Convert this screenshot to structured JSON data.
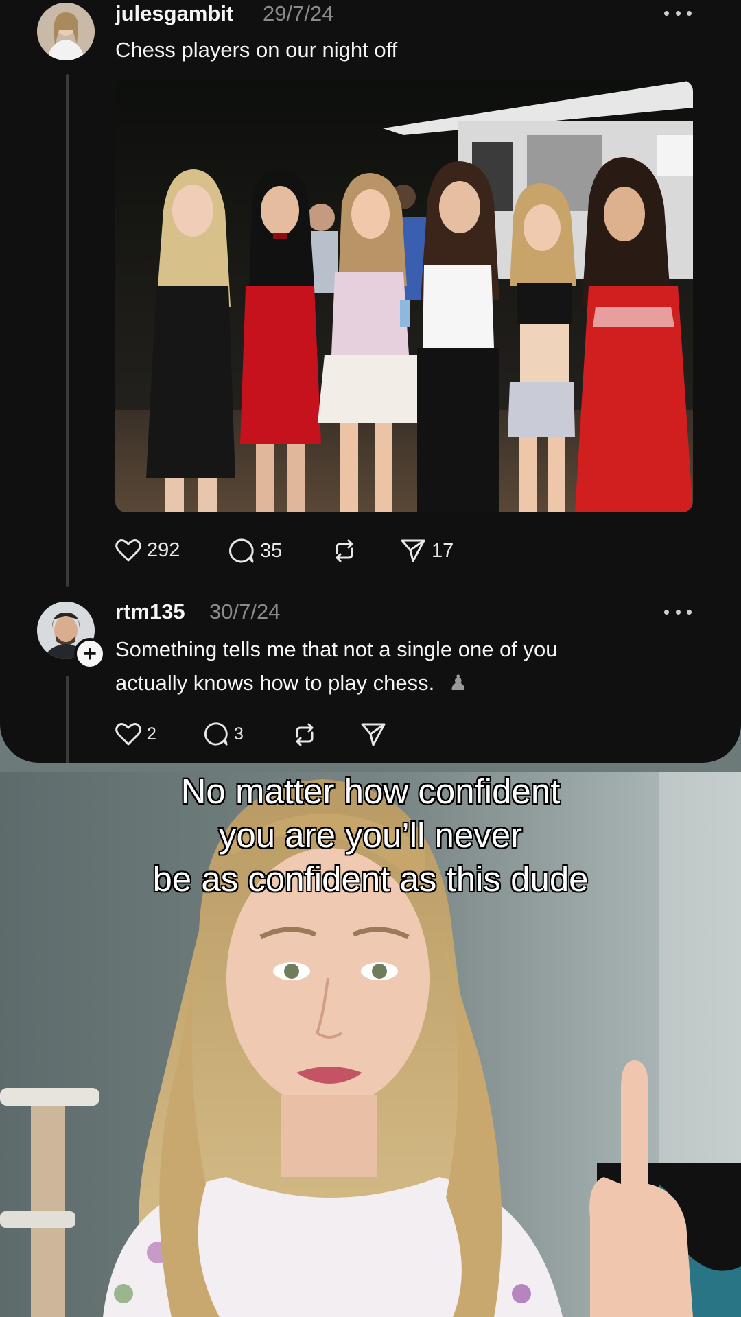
{
  "post": {
    "username": "julesgambit",
    "date": "29/7/24",
    "text": "Chess players on our night off",
    "image_alt_icon": "group-photo",
    "likes": "292",
    "replies": "35",
    "reposts": "",
    "shares": "17"
  },
  "reply": {
    "username": "rtm135",
    "date": "30/7/24",
    "text_line1": "Something tells me that not a single one of you",
    "text_line2": "actually knows how to play chess.",
    "chess_icon": "♟",
    "likes": "2",
    "replies": "3",
    "reposts": "",
    "shares": ""
  },
  "caption": {
    "line1": "No matter how confident",
    "line2": "you are you’ll never",
    "line3": "be as confident as this dude"
  },
  "colors": {
    "card_bg": "#101010",
    "text": "#f3f5f7",
    "muted": "#8a8a8a",
    "video_bg": "#6b7877"
  }
}
